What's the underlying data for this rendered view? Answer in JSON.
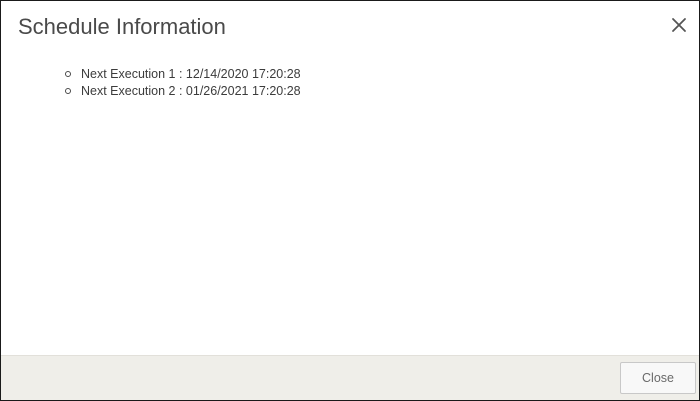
{
  "dialog": {
    "title": "Schedule Information",
    "close_icon": "close-icon",
    "executions": [
      {
        "label": "Next Execution 1 : 12/14/2020 17:20:28"
      },
      {
        "label": "Next Execution 2 : 01/26/2021 17:20:28"
      }
    ],
    "footer": {
      "close_label": "Close"
    }
  },
  "colors": {
    "border": "#1a1a1a",
    "footer_bg": "#efeee9",
    "title_text": "#4a4a4a",
    "body_text": "#3c3c3c"
  }
}
